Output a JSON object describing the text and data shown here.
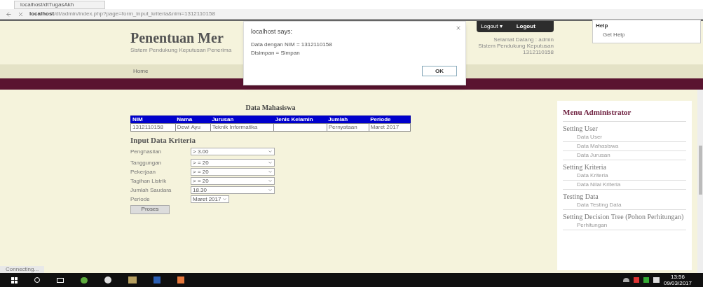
{
  "browser": {
    "tab_title": "localhost/dtTugasAkh",
    "url_host": "localhost",
    "url_path": "/dt/admin/index.php?page=form_input_kriteria&nim=1312110158"
  },
  "site": {
    "title": "Penentuan Mer",
    "subtitle": "Sistem Pendukung Keputusan Penerima",
    "nav": [
      {
        "label": "Home",
        "selected": false
      }
    ],
    "user_menu": {
      "label": "Logout ▾",
      "action": "Logout"
    },
    "user_info": [
      "Selamat Datang : admin",
      "Sistem Pendukung Keputusan",
      "1312110158"
    ]
  },
  "chrome_menu": {
    "title": "Help",
    "item": "Get Help"
  },
  "alert": {
    "title": "localhost says:",
    "message": "Data dengan NIM = 1312110158",
    "message_2": "Disimpan = Simpan",
    "ok": "OK"
  },
  "student_table": {
    "title": "Data Mahasiswa",
    "columns": [
      "NIM",
      "Nama",
      "Jurusan",
      "Jenis Kelamin",
      "Jumlah",
      "Periode"
    ],
    "rows": [
      [
        "1312110158",
        "Dewi Ayu",
        "Teknik Informatika",
        "",
        "Pernyataan",
        "Maret 2017"
      ]
    ]
  },
  "criteria_form": {
    "title": "Input Data Kriteria",
    "fields": [
      {
        "label": "Penghasilan",
        "value": "> 3.00"
      },
      {
        "label": "Tanggungan",
        "value": "> = 20"
      },
      {
        "label": "Pekerjaan",
        "value": "> = 20"
      },
      {
        "label": "Tagihan Listrik",
        "value": "> = 20"
      },
      {
        "label": "Jumlah Saudara",
        "value": "18.30"
      }
    ],
    "period": {
      "label": "Periode",
      "value": "Maret 2017"
    },
    "submit": "Proses"
  },
  "sidebar": {
    "title": "Menu Administrator",
    "sections": [
      {
        "title": "Setting User",
        "items": [
          "Data User",
          "Data Mahasiswa",
          "Data Jurusan"
        ]
      },
      {
        "title": "Setting Kriteria",
        "items": [
          "Data Kriteria",
          "Data Nilai Kriteria"
        ]
      },
      {
        "title": "Testing Data",
        "items": [
          "Data Testing Data"
        ]
      },
      {
        "title": "Setting Decision Tree (Pohon Perhitungan)",
        "items": [
          "Perhitungan"
        ]
      }
    ]
  },
  "status_bar": "Connecting...",
  "taskbar": {
    "time": "13:56",
    "date": "09/03/2017"
  }
}
